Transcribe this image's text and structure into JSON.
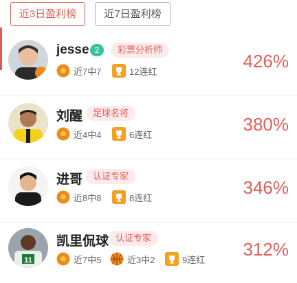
{
  "tabs": [
    {
      "label": "近3日盈利榜",
      "active": true
    },
    {
      "label": "近7日盈利榜",
      "active": false
    }
  ],
  "colors": {
    "accent": "#e0605a",
    "tag_bg": "#fdeaea",
    "level_badge": "#3cc1a1",
    "ball_icon": "#f08a1a",
    "trophy_icon": "#f4a020"
  },
  "experts": [
    {
      "name": "jesse",
      "level": "2",
      "title": "彩票分析师",
      "stats": [
        {
          "icon": "soccer-ball-icon",
          "text": "近7中7"
        },
        {
          "icon": "trophy-icon",
          "text": "12连红"
        }
      ],
      "rate": "426%"
    },
    {
      "name": "刘醒",
      "title": "足球名将",
      "stats": [
        {
          "icon": "soccer-ball-icon",
          "text": "近4中4"
        },
        {
          "icon": "trophy-icon",
          "text": "6连红"
        }
      ],
      "rate": "380%"
    },
    {
      "name": "进哥",
      "title": "认证专家",
      "stats": [
        {
          "icon": "soccer-ball-icon",
          "text": "近8中8"
        },
        {
          "icon": "trophy-icon",
          "text": "8连红"
        }
      ],
      "rate": "346%"
    },
    {
      "name": "凯里侃球",
      "title": "认证专家",
      "stats": [
        {
          "icon": "soccer-ball-icon",
          "text": "近7中5"
        },
        {
          "icon": "basketball-icon",
          "text": "近3中2"
        },
        {
          "icon": "trophy-icon",
          "text": "9连红"
        }
      ],
      "rate": "312%"
    }
  ]
}
